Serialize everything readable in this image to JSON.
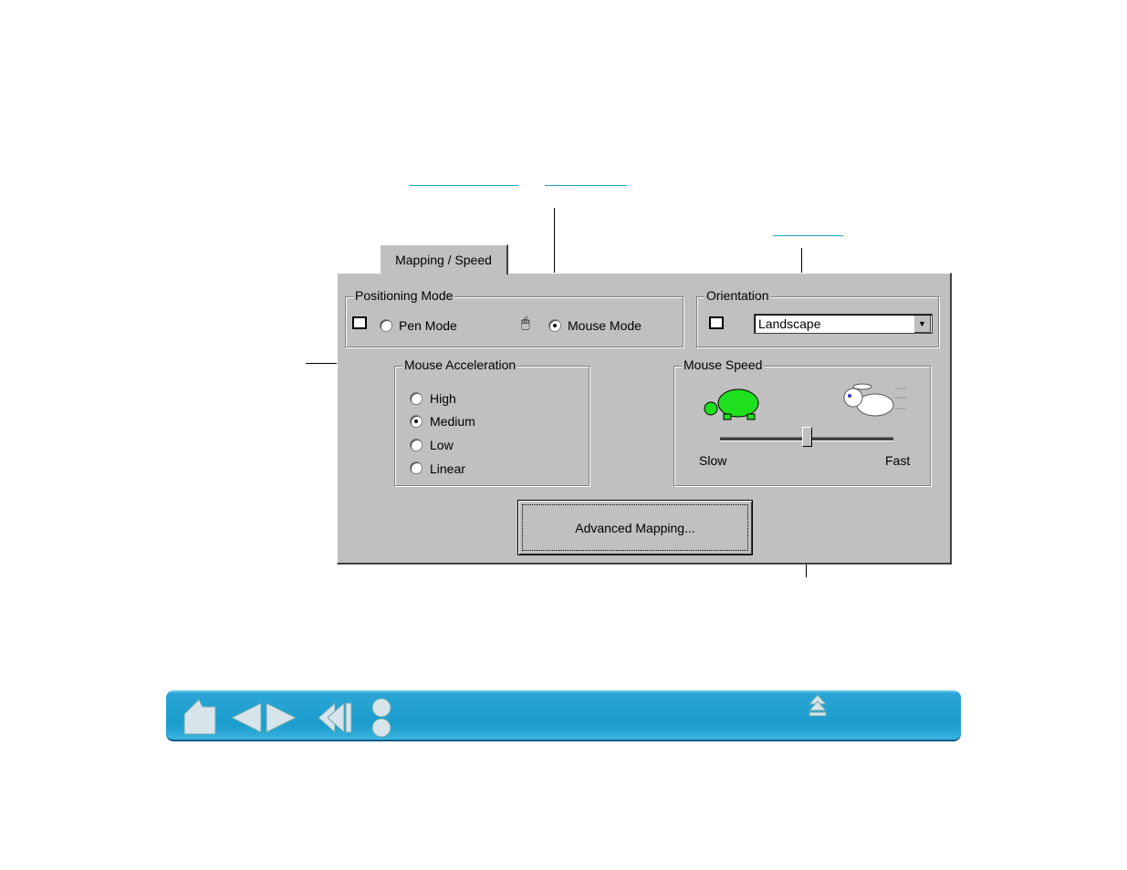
{
  "dialog": {
    "tab": "Mapping / Speed",
    "positioning_mode": {
      "label": "Positioning Mode",
      "pen_mode": "Pen Mode",
      "mouse_mode": "Mouse Mode",
      "selected": "Mouse Mode"
    },
    "orientation": {
      "label": "Orientation",
      "value": "Landscape"
    },
    "mouse_acceleration": {
      "label": "Mouse Acceleration",
      "options": [
        "High",
        "Medium",
        "Low",
        "Linear"
      ],
      "selected": "Medium"
    },
    "mouse_speed": {
      "label": "Mouse Speed",
      "slow": "Slow",
      "fast": "Fast",
      "value_percent": 50
    },
    "advanced_button": "Advanced Mapping..."
  },
  "navbar": {
    "icons": [
      "home-icon",
      "previous-page-icon",
      "next-page-icon",
      "back-icon",
      "index-contents-icon",
      "top-icon"
    ]
  },
  "colors": {
    "dialog_bg": "#c0c0c0",
    "nav_bg": "#1b9ccd",
    "link": "#1aa3b8"
  }
}
